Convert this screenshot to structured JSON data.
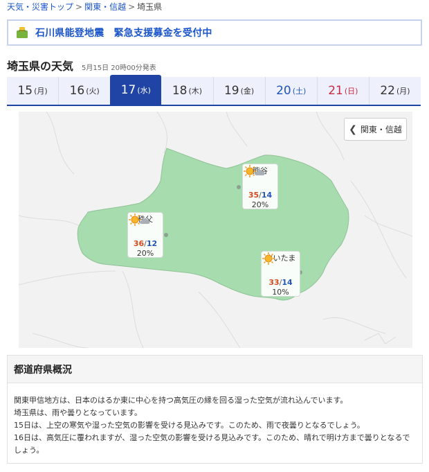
{
  "breadcrumb": {
    "items": [
      {
        "label": "天気・災害トップ"
      },
      {
        "label": "関東・信越"
      },
      {
        "label": "埼玉県"
      }
    ],
    "separator": ">"
  },
  "banner": {
    "text": "石川県能登地震　緊急支援募金を受付中",
    "icon": "donation-box-icon",
    "color": "#1a55c9"
  },
  "page": {
    "title": "埼玉県の天気",
    "published": "5月15日 20時00分発表"
  },
  "tabs": [
    {
      "day": "15",
      "weekday": "(月)"
    },
    {
      "day": "16",
      "weekday": "(火)"
    },
    {
      "day": "17",
      "weekday": "(水)"
    },
    {
      "day": "18",
      "weekday": "(木)"
    },
    {
      "day": "19",
      "weekday": "(金)"
    },
    {
      "day": "20",
      "weekday": "(土)"
    },
    {
      "day": "21",
      "weekday": "(日)"
    },
    {
      "day": "22",
      "weekday": "(月)"
    }
  ],
  "active_tab": "17 (水)",
  "map": {
    "back_button": "関東・信越",
    "cities": [
      {
        "name": "熊谷",
        "high": "35",
        "low": "14",
        "rain": "20%",
        "weather": "sunny-then-cloudy"
      },
      {
        "name": "秩父",
        "high": "36",
        "low": "12",
        "rain": "20%",
        "weather": "sunny-then-cloudy"
      },
      {
        "name": "さいたま",
        "high": "33",
        "low": "14",
        "rain": "10%",
        "weather": "sunny"
      }
    ],
    "colors": {
      "prefecture": "#a7dcae",
      "background": "#f2f2f2",
      "high_temp": "#d24b1f",
      "low_temp": "#2355b8"
    }
  },
  "summary": {
    "heading": "都道府県概況",
    "paragraphs": [
      "関東甲信地方は、日本のはるか東に中心を持つ高気圧の縁を回る湿った空気が流れ込んでいます。",
      "埼玉県は、雨や曇りとなっています。",
      "15日は、上空の寒気や湿った空気の影響を受ける見込みです。このため、雨で夜曇りとなるでしょう。",
      "16日は、高気圧に覆われますが、湿った空気の影響を受ける見込みです。このため、晴れで明け方まで曇りとなるでしょう。"
    ]
  }
}
